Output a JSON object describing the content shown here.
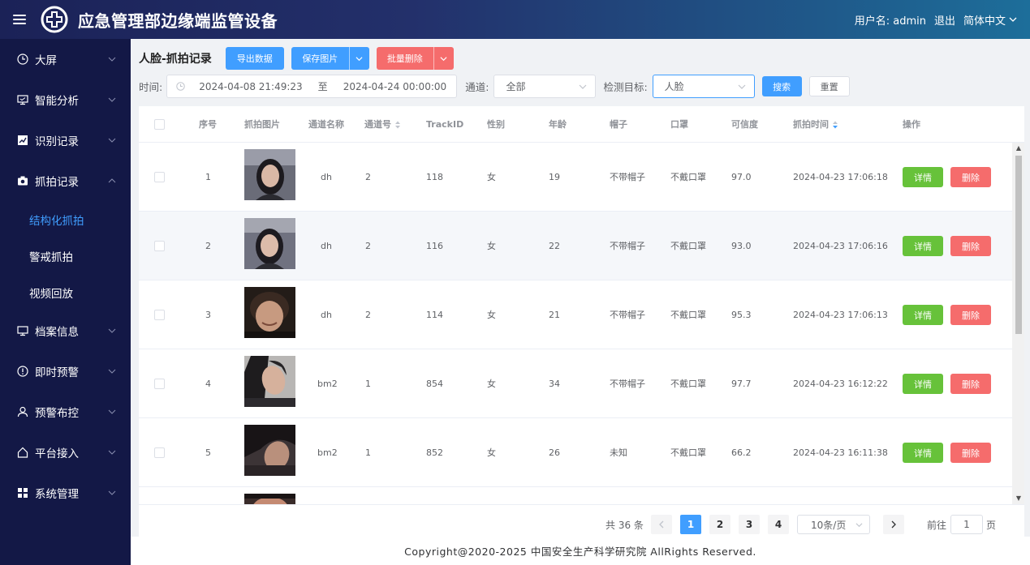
{
  "header": {
    "title": "应急管理部边缘端监管设备",
    "username_label": "用户名: admin",
    "logout": "退出",
    "language": "简体中文"
  },
  "sidebar": {
    "items": [
      {
        "label": "大屏",
        "icon": "clock-icon"
      },
      {
        "label": "智能分析",
        "icon": "monitor-icon"
      },
      {
        "label": "识别记录",
        "icon": "chart-icon"
      },
      {
        "label": "抓拍记录",
        "icon": "camera-icon"
      },
      {
        "label": "档案信息",
        "icon": "desktop-icon"
      },
      {
        "label": "即时预警",
        "icon": "warning-icon"
      },
      {
        "label": "预警布控",
        "icon": "user-icon"
      },
      {
        "label": "平台接入",
        "icon": "home-icon"
      },
      {
        "label": "系统管理",
        "icon": "grid-icon"
      }
    ],
    "subitems": [
      {
        "label": "结构化抓拍",
        "active": true
      },
      {
        "label": "警戒抓拍",
        "active": false
      },
      {
        "label": "视频回放",
        "active": false
      }
    ]
  },
  "toolbar": {
    "page_title": "人脸-抓拍记录",
    "export_label": "导出数据",
    "save_images_label": "保存图片",
    "batch_delete_label": "批量删除"
  },
  "filters": {
    "time_label": "时间:",
    "start_time": "2024-04-08 21:49:23",
    "range_sep": "至",
    "end_time": "2024-04-24 00:00:00",
    "channel_label": "通道:",
    "channel_value": "全部",
    "target_label": "检测目标:",
    "target_value": "人脸",
    "search_label": "搜索",
    "reset_label": "重置"
  },
  "table": {
    "columns": [
      "序号",
      "抓拍图片",
      "通道名称",
      "通道号",
      "TrackID",
      "性别",
      "年龄",
      "帽子",
      "口罩",
      "可信度",
      "抓拍时间",
      "操作"
    ],
    "detail_label": "详情",
    "delete_label": "删除",
    "rows": [
      {
        "index": "1",
        "channel_name": "dh",
        "channel_no": "2",
        "track_id": "118",
        "gender": "女",
        "age": "19",
        "hat": "不带帽子",
        "mask": "不戴口罩",
        "confidence": "97.0",
        "time": "2024-04-23 17:06:18"
      },
      {
        "index": "2",
        "channel_name": "dh",
        "channel_no": "2",
        "track_id": "116",
        "gender": "女",
        "age": "22",
        "hat": "不带帽子",
        "mask": "不戴口罩",
        "confidence": "93.0",
        "time": "2024-04-23 17:06:16"
      },
      {
        "index": "3",
        "channel_name": "dh",
        "channel_no": "2",
        "track_id": "114",
        "gender": "女",
        "age": "21",
        "hat": "不带帽子",
        "mask": "不戴口罩",
        "confidence": "95.3",
        "time": "2024-04-23 17:06:13"
      },
      {
        "index": "4",
        "channel_name": "bm2",
        "channel_no": "1",
        "track_id": "854",
        "gender": "女",
        "age": "34",
        "hat": "不带帽子",
        "mask": "不戴口罩",
        "confidence": "97.7",
        "time": "2024-04-23 16:12:22"
      },
      {
        "index": "5",
        "channel_name": "bm2",
        "channel_no": "1",
        "track_id": "852",
        "gender": "女",
        "age": "26",
        "hat": "未知",
        "mask": "不戴口罩",
        "confidence": "66.2",
        "time": "2024-04-23 16:11:38"
      }
    ]
  },
  "pagination": {
    "total": "共 36 条",
    "pages": [
      "1",
      "2",
      "3",
      "4"
    ],
    "current_page": "1",
    "page_size": "10条/页",
    "goto_label": "前往",
    "goto_value": "1",
    "page_suffix": "页"
  },
  "footer": {
    "copyright": "Copyright@2020-2025 中国安全生产科学研究院 AllRights Reserved."
  },
  "colors": {
    "primary": "#409eff",
    "success": "#67c23a",
    "danger": "#f56c6c",
    "sidebar_bg": "#131846"
  }
}
